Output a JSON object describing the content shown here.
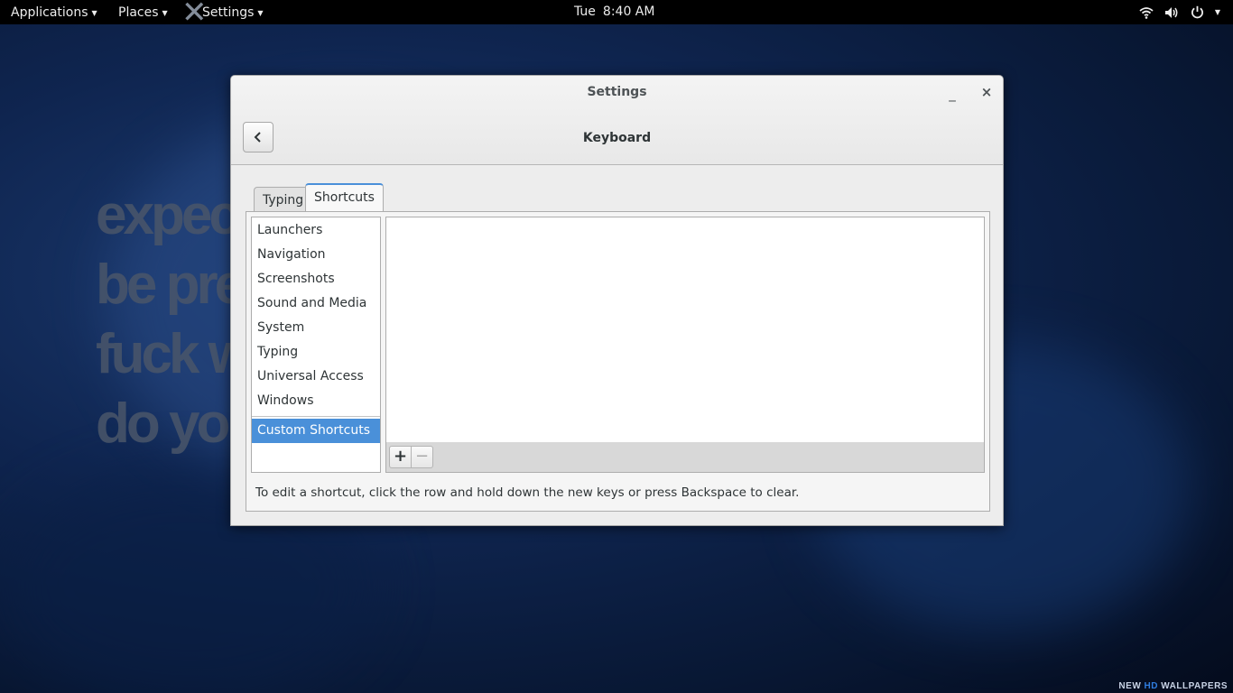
{
  "topbar": {
    "applications_label": "Applications",
    "places_label": "Places",
    "settings_label": "Settings",
    "day": "Tue",
    "time": "8:40 AM",
    "icons": [
      "wifi-icon",
      "volume-icon",
      "power-icon"
    ]
  },
  "wallpaper": {
    "lines": [
      "expec",
      "be pre",
      "fuck w",
      "do yo"
    ],
    "brand_new": "NEW",
    "brand_hd": "HD",
    "brand_wallpapers": "WALLPAPERS"
  },
  "window": {
    "title": "Settings",
    "minimize_glyph": "_",
    "close_glyph": "×",
    "page_title": "Keyboard",
    "tabs": [
      {
        "label": "Typing",
        "active": false
      },
      {
        "label": "Shortcuts",
        "active": true
      }
    ],
    "categories": [
      "Launchers",
      "Navigation",
      "Screenshots",
      "Sound and Media",
      "System",
      "Typing",
      "Universal Access",
      "Windows"
    ],
    "custom_category": "Custom Shortcuts",
    "add_glyph": "+",
    "remove_glyph": "−",
    "hint": "To edit a shortcut, click the row and hold down the new keys or press Backspace to clear."
  },
  "colors": {
    "selection": "#4a90d9",
    "topbar_bg": "#000000",
    "window_bg": "#ededed"
  }
}
